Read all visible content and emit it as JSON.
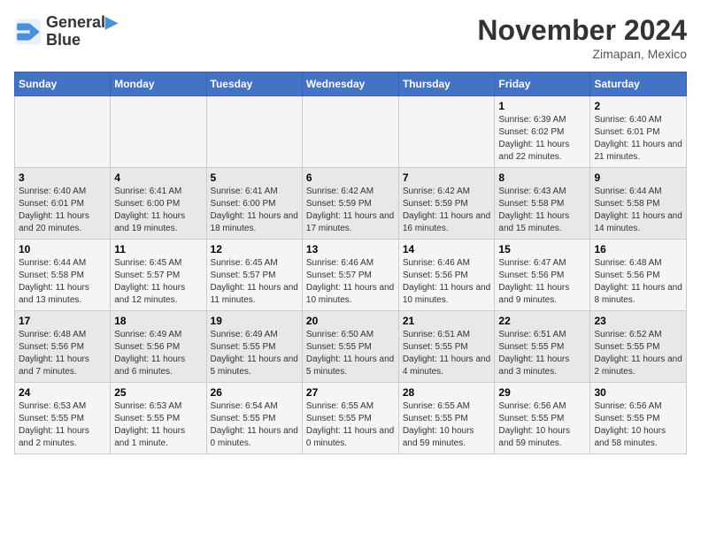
{
  "logo": {
    "line1": "General",
    "line2": "Blue"
  },
  "title": "November 2024",
  "subtitle": "Zimapan, Mexico",
  "headers": [
    "Sunday",
    "Monday",
    "Tuesday",
    "Wednesday",
    "Thursday",
    "Friday",
    "Saturday"
  ],
  "weeks": [
    [
      {
        "day": "",
        "info": ""
      },
      {
        "day": "",
        "info": ""
      },
      {
        "day": "",
        "info": ""
      },
      {
        "day": "",
        "info": ""
      },
      {
        "day": "",
        "info": ""
      },
      {
        "day": "1",
        "info": "Sunrise: 6:39 AM\nSunset: 6:02 PM\nDaylight: 11 hours and 22 minutes."
      },
      {
        "day": "2",
        "info": "Sunrise: 6:40 AM\nSunset: 6:01 PM\nDaylight: 11 hours and 21 minutes."
      }
    ],
    [
      {
        "day": "3",
        "info": "Sunrise: 6:40 AM\nSunset: 6:01 PM\nDaylight: 11 hours and 20 minutes."
      },
      {
        "day": "4",
        "info": "Sunrise: 6:41 AM\nSunset: 6:00 PM\nDaylight: 11 hours and 19 minutes."
      },
      {
        "day": "5",
        "info": "Sunrise: 6:41 AM\nSunset: 6:00 PM\nDaylight: 11 hours and 18 minutes."
      },
      {
        "day": "6",
        "info": "Sunrise: 6:42 AM\nSunset: 5:59 PM\nDaylight: 11 hours and 17 minutes."
      },
      {
        "day": "7",
        "info": "Sunrise: 6:42 AM\nSunset: 5:59 PM\nDaylight: 11 hours and 16 minutes."
      },
      {
        "day": "8",
        "info": "Sunrise: 6:43 AM\nSunset: 5:58 PM\nDaylight: 11 hours and 15 minutes."
      },
      {
        "day": "9",
        "info": "Sunrise: 6:44 AM\nSunset: 5:58 PM\nDaylight: 11 hours and 14 minutes."
      }
    ],
    [
      {
        "day": "10",
        "info": "Sunrise: 6:44 AM\nSunset: 5:58 PM\nDaylight: 11 hours and 13 minutes."
      },
      {
        "day": "11",
        "info": "Sunrise: 6:45 AM\nSunset: 5:57 PM\nDaylight: 11 hours and 12 minutes."
      },
      {
        "day": "12",
        "info": "Sunrise: 6:45 AM\nSunset: 5:57 PM\nDaylight: 11 hours and 11 minutes."
      },
      {
        "day": "13",
        "info": "Sunrise: 6:46 AM\nSunset: 5:57 PM\nDaylight: 11 hours and 10 minutes."
      },
      {
        "day": "14",
        "info": "Sunrise: 6:46 AM\nSunset: 5:56 PM\nDaylight: 11 hours and 10 minutes."
      },
      {
        "day": "15",
        "info": "Sunrise: 6:47 AM\nSunset: 5:56 PM\nDaylight: 11 hours and 9 minutes."
      },
      {
        "day": "16",
        "info": "Sunrise: 6:48 AM\nSunset: 5:56 PM\nDaylight: 11 hours and 8 minutes."
      }
    ],
    [
      {
        "day": "17",
        "info": "Sunrise: 6:48 AM\nSunset: 5:56 PM\nDaylight: 11 hours and 7 minutes."
      },
      {
        "day": "18",
        "info": "Sunrise: 6:49 AM\nSunset: 5:56 PM\nDaylight: 11 hours and 6 minutes."
      },
      {
        "day": "19",
        "info": "Sunrise: 6:49 AM\nSunset: 5:55 PM\nDaylight: 11 hours and 5 minutes."
      },
      {
        "day": "20",
        "info": "Sunrise: 6:50 AM\nSunset: 5:55 PM\nDaylight: 11 hours and 5 minutes."
      },
      {
        "day": "21",
        "info": "Sunrise: 6:51 AM\nSunset: 5:55 PM\nDaylight: 11 hours and 4 minutes."
      },
      {
        "day": "22",
        "info": "Sunrise: 6:51 AM\nSunset: 5:55 PM\nDaylight: 11 hours and 3 minutes."
      },
      {
        "day": "23",
        "info": "Sunrise: 6:52 AM\nSunset: 5:55 PM\nDaylight: 11 hours and 2 minutes."
      }
    ],
    [
      {
        "day": "24",
        "info": "Sunrise: 6:53 AM\nSunset: 5:55 PM\nDaylight: 11 hours and 2 minutes."
      },
      {
        "day": "25",
        "info": "Sunrise: 6:53 AM\nSunset: 5:55 PM\nDaylight: 11 hours and 1 minute."
      },
      {
        "day": "26",
        "info": "Sunrise: 6:54 AM\nSunset: 5:55 PM\nDaylight: 11 hours and 0 minutes."
      },
      {
        "day": "27",
        "info": "Sunrise: 6:55 AM\nSunset: 5:55 PM\nDaylight: 11 hours and 0 minutes."
      },
      {
        "day": "28",
        "info": "Sunrise: 6:55 AM\nSunset: 5:55 PM\nDaylight: 10 hours and 59 minutes."
      },
      {
        "day": "29",
        "info": "Sunrise: 6:56 AM\nSunset: 5:55 PM\nDaylight: 10 hours and 59 minutes."
      },
      {
        "day": "30",
        "info": "Sunrise: 6:56 AM\nSunset: 5:55 PM\nDaylight: 10 hours and 58 minutes."
      }
    ]
  ]
}
